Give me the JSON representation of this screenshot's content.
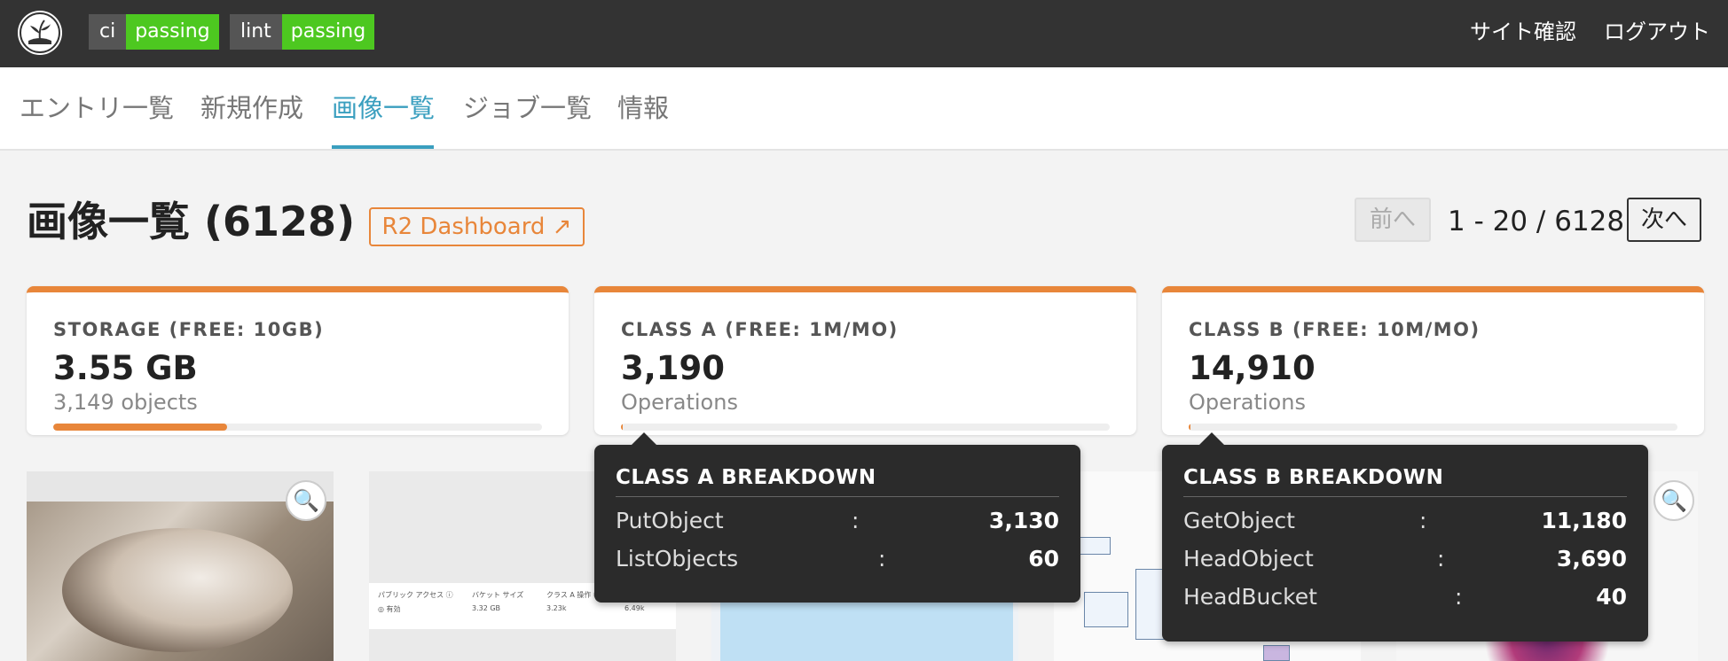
{
  "header": {
    "badges": [
      {
        "key": "ci",
        "value": "passing"
      },
      {
        "key": "lint",
        "value": "passing"
      }
    ],
    "site_check_label": "サイト確認",
    "logout_label": "ログアウト"
  },
  "nav": {
    "tabs": [
      {
        "label": "エントリ一覧"
      },
      {
        "label": "新規作成"
      },
      {
        "label": "画像一覧",
        "active": true
      },
      {
        "label": "ジョブ一覧"
      },
      {
        "label": "情報"
      }
    ]
  },
  "page": {
    "title": "画像一覧 (6128)",
    "r2_dashboard_label": "R2 Dashboard ↗",
    "prev_label": "前へ",
    "range_label": "1 - 20 / 6128",
    "next_label": "次へ"
  },
  "stats": [
    {
      "label": "STORAGE (FREE: 10GB)",
      "value": "3.55 GB",
      "sub": "3,149 objects",
      "fraction": 0.355
    },
    {
      "label": "CLASS A (FREE: 1M/MO)",
      "value": "3,190",
      "sub": "Operations",
      "fraction": 0.0032
    },
    {
      "label": "CLASS B (FREE: 10M/MO)",
      "value": "14,910",
      "sub": "Operations",
      "fraction": 0.0015
    }
  ],
  "tooltips": {
    "class_a": {
      "title": "CLASS A BREAKDOWN",
      "rows": [
        {
          "name": "PutObject",
          "value": "3,130"
        },
        {
          "name": "ListObjects",
          "value": "60"
        }
      ]
    },
    "class_b": {
      "title": "CLASS B BREAKDOWN",
      "rows": [
        {
          "name": "GetObject",
          "value": "11,180"
        },
        {
          "name": "HeadObject",
          "value": "3,690"
        },
        {
          "name": "HeadBucket",
          "value": "40"
        }
      ]
    },
    "separator": ":"
  },
  "thumbnails": {
    "table_headers": [
      "パブリック アクセス ⓘ",
      "バケット サイズ",
      "クラス A 操作 ⓘ"
    ],
    "table_values": [
      "◎ 有効",
      "3.32 GB",
      "3.23k",
      "6.49k"
    ]
  },
  "colors": {
    "accent_orange": "#e8863a",
    "active_tab": "#3a9fbf",
    "badge_green": "#4dc820",
    "topbar": "#333333"
  },
  "icons": {
    "logo": "plant-logo-icon",
    "zoom": "magnifier-icon"
  }
}
